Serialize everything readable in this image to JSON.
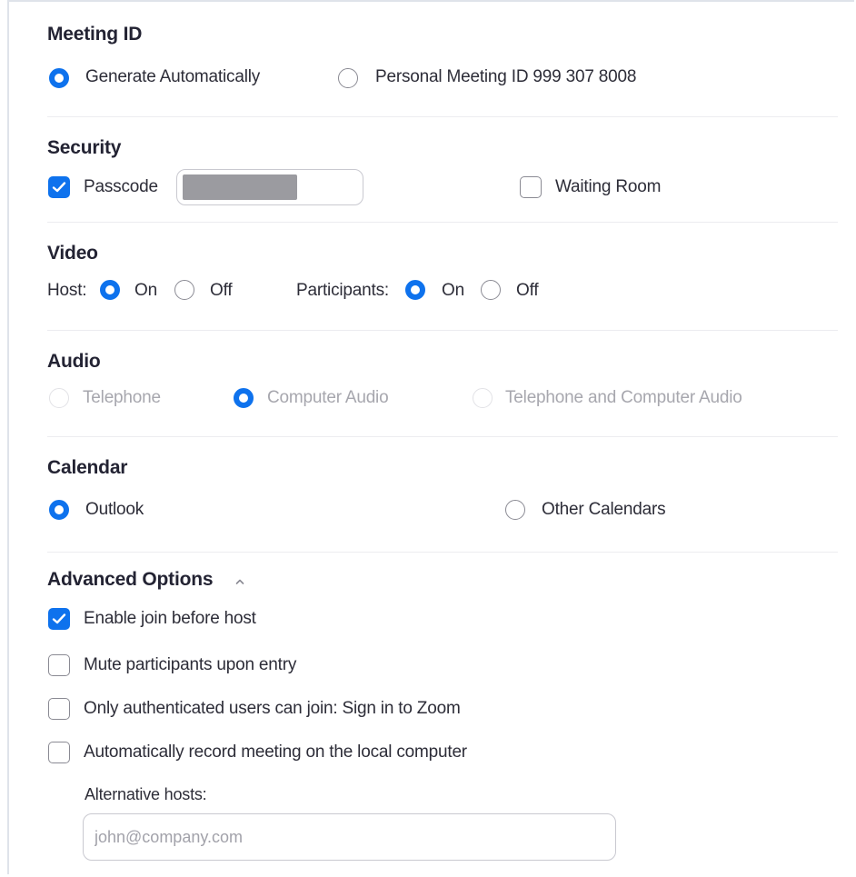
{
  "meeting_id": {
    "heading": "Meeting ID",
    "options": [
      {
        "label": "Generate Automatically",
        "selected": true
      },
      {
        "label": "Personal Meeting ID 999 307 8008",
        "selected": false
      }
    ]
  },
  "security": {
    "heading": "Security",
    "passcode_label": "Passcode",
    "passcode_checked": true,
    "waiting_room_label": "Waiting Room",
    "waiting_room_checked": false
  },
  "video": {
    "heading": "Video",
    "host_label": "Host:",
    "participants_label": "Participants:",
    "on_label": "On",
    "off_label": "Off",
    "host_value": "On",
    "participants_value": "On"
  },
  "audio": {
    "heading": "Audio",
    "options": [
      {
        "label": "Telephone",
        "selected": false,
        "disabled": true
      },
      {
        "label": "Computer Audio",
        "selected": true,
        "disabled": false
      },
      {
        "label": "Telephone and Computer Audio",
        "selected": false,
        "disabled": true
      }
    ]
  },
  "calendar": {
    "heading": "Calendar",
    "options": [
      {
        "label": "Outlook",
        "selected": true
      },
      {
        "label": "Other Calendars",
        "selected": false
      }
    ]
  },
  "advanced": {
    "heading": "Advanced Options",
    "options": [
      {
        "label": "Enable join before host",
        "checked": true
      },
      {
        "label": "Mute participants upon entry",
        "checked": false
      },
      {
        "label": "Only authenticated users can join: Sign in to Zoom",
        "checked": false
      },
      {
        "label": "Automatically record meeting on the local computer",
        "checked": false
      }
    ],
    "alt_hosts_label": "Alternative hosts:",
    "alt_hosts_placeholder": "john@company.com"
  },
  "colors": {
    "accent": "#0e72ed",
    "text": "#232333",
    "disabled_text": "#a7a7ae",
    "divider": "#ececf0"
  }
}
